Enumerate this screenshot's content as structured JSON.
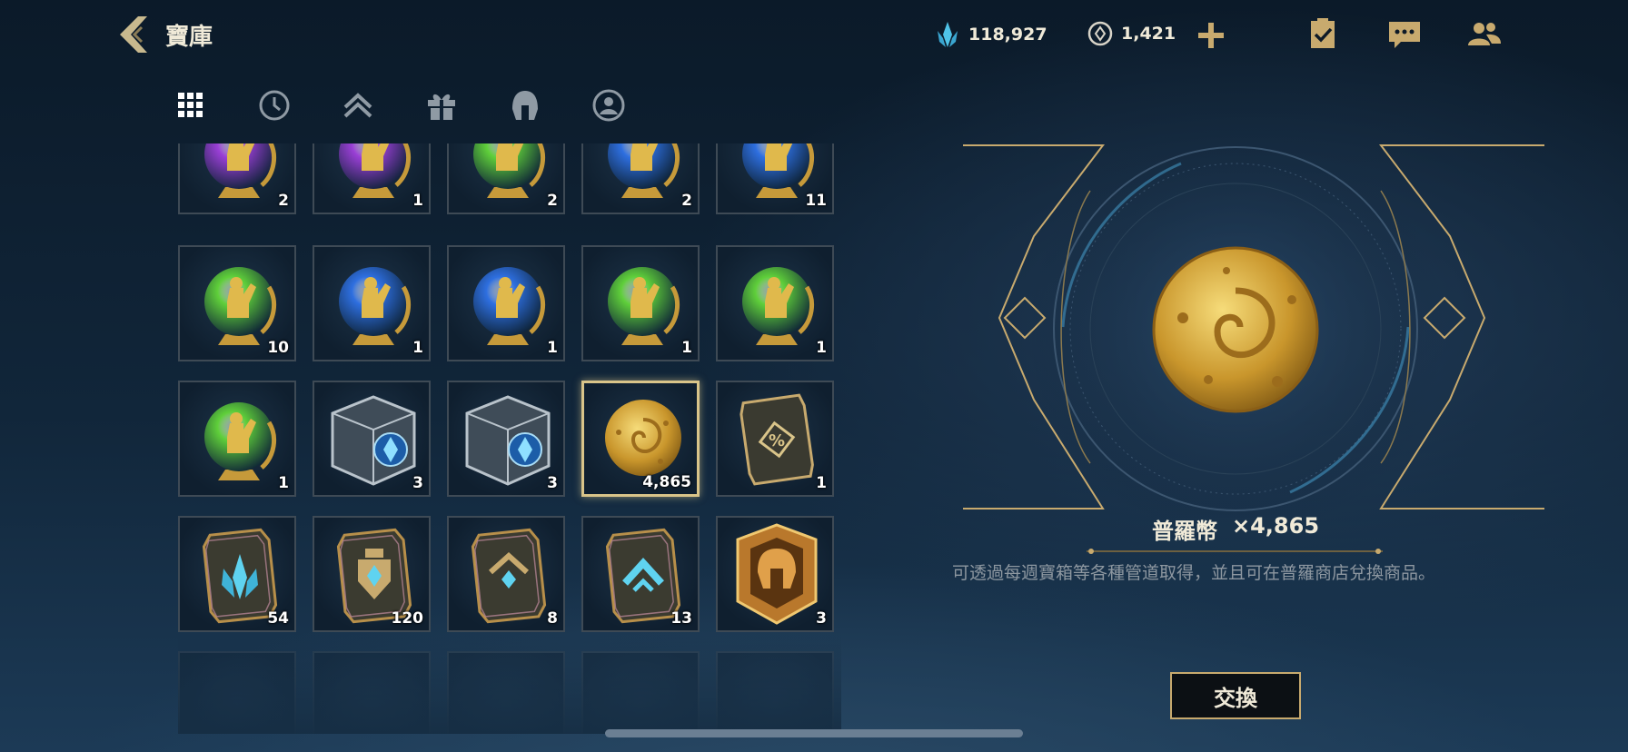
{
  "header": {
    "title": "寶庫",
    "currency_blue_essence": "118,927",
    "currency_orange": "1,421"
  },
  "tabs": [
    {
      "icon": "grid-icon"
    },
    {
      "icon": "clock-icon"
    },
    {
      "icon": "rank-chevron-icon"
    },
    {
      "icon": "gift-icon"
    },
    {
      "icon": "helmet-icon"
    },
    {
      "icon": "profile-icon"
    }
  ],
  "inventory": {
    "rows": [
      [
        {
          "type": "orb-purple",
          "count": "2"
        },
        {
          "type": "orb-purple",
          "count": "1"
        },
        {
          "type": "orb-green",
          "count": "2"
        },
        {
          "type": "orb-blue",
          "count": "2"
        },
        {
          "type": "orb-blue",
          "count": "11"
        }
      ],
      [
        {
          "type": "orb-green",
          "count": "10"
        },
        {
          "type": "orb-blue",
          "count": "1"
        },
        {
          "type": "orb-blue",
          "count": "1"
        },
        {
          "type": "orb-green",
          "count": "1"
        },
        {
          "type": "orb-green",
          "count": "1"
        }
      ],
      [
        {
          "type": "orb-green",
          "count": "1"
        },
        {
          "type": "cube",
          "count": "3"
        },
        {
          "type": "cube",
          "count": "3"
        },
        {
          "type": "coin",
          "count": "4,865",
          "selected": true
        },
        {
          "type": "coupon",
          "count": "1"
        }
      ],
      [
        {
          "type": "card-crystal",
          "count": "54"
        },
        {
          "type": "card-crest",
          "count": "120"
        },
        {
          "type": "card-gem",
          "count": "8"
        },
        {
          "type": "card-chevron",
          "count": "13"
        },
        {
          "type": "emblem",
          "count": "3"
        }
      ]
    ]
  },
  "detail": {
    "name": "普羅幣",
    "quantity": "×4,865",
    "description": "可透過每週寶箱等各種管道取得，並且可在普羅商店兌換商品。",
    "exchange_label": "交換"
  },
  "colors": {
    "gold": "#c8aa6e",
    "blue_essence": "#4fc3e8",
    "orb_green": "#5fcf3a",
    "orb_blue": "#2e6fe0",
    "orb_purple": "#9a3fd6"
  }
}
